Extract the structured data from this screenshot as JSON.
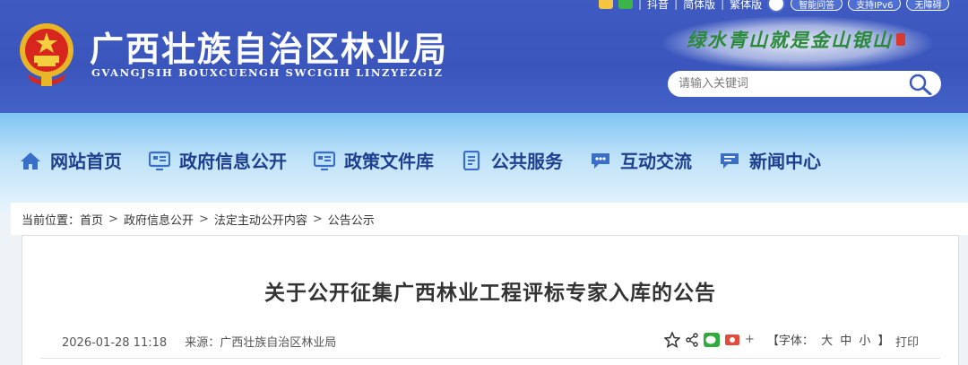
{
  "site": {
    "title": "广西壮族自治区林业局",
    "subtitle": "GVANGJSIH BOUXCUENGH SWCIGIH LINZYEZGIZ",
    "slogan": "绿水青山就是金山银山"
  },
  "toplinks": {
    "douyin": "抖音",
    "simplified": "简体版",
    "traditional": "繁体版",
    "smart_qa": "智能问答",
    "ipv6": "支持IPv6",
    "accessibility": "无障碍"
  },
  "search": {
    "placeholder": "请输入关键词"
  },
  "nav": {
    "items": [
      {
        "label": "网站首页",
        "icon": "home-icon"
      },
      {
        "label": "政府信息公开",
        "icon": "info-board-icon"
      },
      {
        "label": "政策文件库",
        "icon": "policy-board-icon"
      },
      {
        "label": "公共服务",
        "icon": "document-icon"
      },
      {
        "label": "互动交流",
        "icon": "chat-icon"
      },
      {
        "label": "新闻中心",
        "icon": "news-icon"
      }
    ]
  },
  "breadcrumb": {
    "prefix": "当前位置：",
    "items": [
      "首页",
      "政府信息公开",
      "法定主动公开内容",
      "公告公示"
    ],
    "sep": ">"
  },
  "article": {
    "title": "关于公开征集广西林业工程评标专家入库的公告",
    "date": "2026-01-28 11:18",
    "source": "来源：广西壮族自治区林业局",
    "font_size": {
      "label": "【字体：",
      "large": "大",
      "medium": "中",
      "small": "小",
      "close": "】"
    },
    "print": "打印",
    "plus": "+"
  },
  "colors": {
    "header_blue": "#3f5bc2",
    "nav_text": "#1d3f8e",
    "slogan_green": "#2a8a3a"
  }
}
